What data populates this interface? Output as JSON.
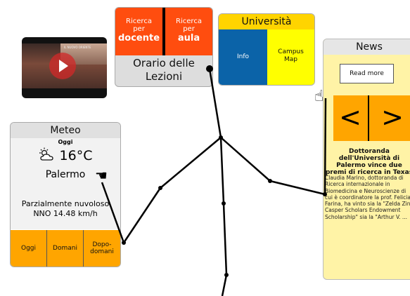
{
  "video": {
    "caption": "IL NUOVO ORIENTE"
  },
  "ricerca": {
    "docente": {
      "line1": "Ricerca",
      "line2": "per",
      "bold": "docente"
    },
    "aula": {
      "line1": "Ricerca",
      "line2": "per",
      "bold": "aula"
    },
    "orario_line1": "Orario delle",
    "orario_line2": "Lezioni"
  },
  "universita": {
    "title": "Università",
    "info": "Info",
    "campus_line1": "Campus",
    "campus_line2": "Map"
  },
  "news": {
    "title": "News",
    "read_more": "Read more",
    "prev": "<",
    "next": ">",
    "headline": "Dottoranda dell'Università di Palermo vince due premi di ricerca in Texas",
    "body": "Claudia Marino, dottoranda di Ricerca internazionale in Biomedicina e Neuroscienze di cui è coordinatore la prof. Felicia Farina, ha vinto sia la \"Zelda Zinn Casper Scholars Endowment Scholarship\" sia la \"Arthur V. ..."
  },
  "meteo": {
    "title": "Meteo",
    "day": "Oggi",
    "icon": "☼̇",
    "temperature": "16°C",
    "city": "Palermo",
    "desc_line1": "Parzialmente nuvoloso",
    "desc_line2": "NNO 14.48 km/h",
    "buttons": {
      "oggi": "Oggi",
      "domani": "Domani",
      "dopo_line1": "Dopo-",
      "dopo_line2": "domani"
    }
  },
  "colors": {
    "orange": "#ffa500",
    "red_orange": "#ff4d0f",
    "uni_yellow": "#ffd400",
    "uni_blue": "#0b63a8",
    "news_bg": "#fff3a6"
  }
}
